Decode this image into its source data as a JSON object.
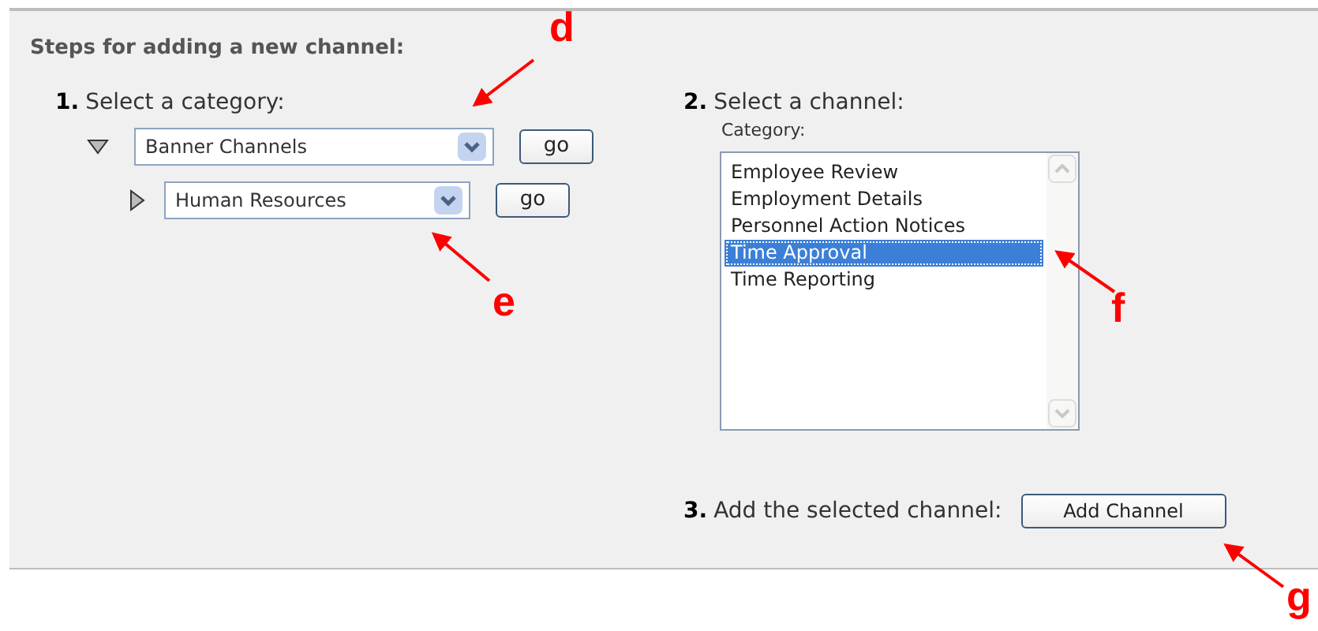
{
  "heading": "Steps for adding a new channel:",
  "step_1": {
    "number": "1.",
    "label": "Select a category:",
    "tree": [
      {
        "value": "Banner Channels",
        "expanded": true,
        "button": "go"
      },
      {
        "value": "Human Resources",
        "expanded": false,
        "button": "go"
      }
    ]
  },
  "step_2": {
    "number": "2.",
    "label": "Select a channel:",
    "sublabel": "Category:",
    "channels": [
      {
        "label": "Employee Review",
        "selected": false
      },
      {
        "label": "Employment Details",
        "selected": false
      },
      {
        "label": "Personnel Action Notices",
        "selected": false
      },
      {
        "label": "Time Approval",
        "selected": true
      },
      {
        "label": "Time Reporting",
        "selected": false
      }
    ]
  },
  "step_3": {
    "number": "3.",
    "label": "Add the selected channel:",
    "button": "Add Channel"
  },
  "annotations": [
    {
      "letter": "d"
    },
    {
      "letter": "e"
    },
    {
      "letter": "f"
    },
    {
      "letter": "g"
    }
  ]
}
